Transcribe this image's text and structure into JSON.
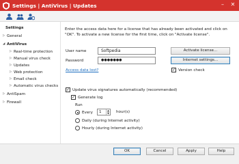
{
  "window": {
    "title": "Settings | AntiVirus | Updates"
  },
  "toolbar": {
    "icons": [
      "user-settings-icon",
      "user-group-icon",
      "user-refresh-icon"
    ]
  },
  "nav": {
    "heading": "Settings",
    "items": [
      {
        "label": "General",
        "arrow": "▷"
      },
      {
        "label": "AntiVirus",
        "arrow": "◢"
      },
      {
        "label": "Real-time protection",
        "arrow": "▷"
      },
      {
        "label": "Manual virus check",
        "arrow": "▷"
      },
      {
        "label": "Updates",
        "arrow": "▷"
      },
      {
        "label": "Web protection",
        "arrow": "▷"
      },
      {
        "label": "Email check",
        "arrow": "▷"
      },
      {
        "label": "Automatic virus checks",
        "arrow": "▷"
      },
      {
        "label": "AntiSpam",
        "arrow": "▷"
      },
      {
        "label": "Firewall",
        "arrow": "▷"
      }
    ]
  },
  "main": {
    "description": "Enter the access data here for a license that has already been activated and click on \"OK\". To activate a new license for the first time, click on \"Activate license\".",
    "username_label": "User name",
    "username_value": "Softpedia",
    "password_label": "Password",
    "password_value": "●●●●●●●",
    "activate_button": "Activate license...",
    "internet_settings_button": "Internet settings...",
    "version_check_label": "Version check",
    "version_check_checked": true,
    "access_data_lost_link": "Access data lost?",
    "auto_update_label": "Update virus signatures automatically (recommended)",
    "auto_update_checked": true,
    "generate_log_label": "Generate log",
    "generate_log_checked": true,
    "run_heading": "Run",
    "every_label": "Every",
    "every_value": "1",
    "hours_label": "hour(s)",
    "daily_label": "Daily (during Internet activity)",
    "hourly_label": "Hourly (during Internet activity)",
    "selected_schedule": "every"
  },
  "footer": {
    "ok": "OK",
    "cancel": "Cancel",
    "apply": "Apply",
    "help": "Help"
  },
  "colors": {
    "titlebar": "#d4332d",
    "link": "#1e6fc0",
    "icon_blue": "#2d5fa3"
  }
}
